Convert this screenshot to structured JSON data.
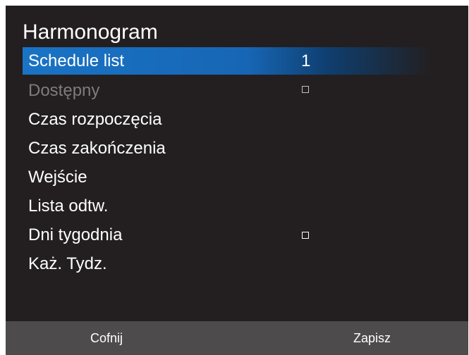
{
  "title": "Harmonogram",
  "menu": {
    "schedule_list": {
      "label": "Schedule list",
      "value": "1"
    },
    "available": {
      "label": "Dostępny"
    },
    "start_time": {
      "label": "Czas rozpoczęcia"
    },
    "end_time": {
      "label": "Czas zakończenia"
    },
    "input": {
      "label": "Wejście"
    },
    "playlist": {
      "label": "Lista odtw."
    },
    "weekdays": {
      "label": "Dni tygodnia"
    },
    "every_week": {
      "label": "Każ. Tydz."
    }
  },
  "footer": {
    "back_label": "Cofnij",
    "save_label": "Zapisz"
  },
  "colors": {
    "background": "#231f20",
    "selection": "#1a73c4",
    "footer": "#4e4b4c",
    "disabled_text": "#7e7b7c"
  }
}
